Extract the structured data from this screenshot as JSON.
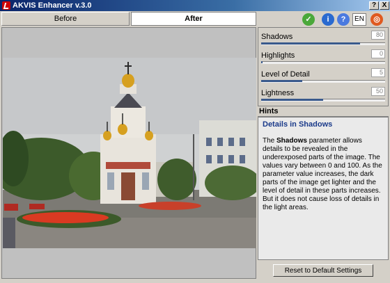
{
  "window": {
    "title": "AKVIS Enhancer v.3.0",
    "help_label": "?",
    "close_label": "X"
  },
  "tabs": [
    {
      "label": "Before"
    },
    {
      "label": "After"
    }
  ],
  "toolbar": {
    "language": "EN"
  },
  "params": [
    {
      "label": "Shadows",
      "value": "80",
      "fraction": 0.8
    },
    {
      "label": "Highlights",
      "value": "0",
      "fraction": 0.0
    },
    {
      "label": "Level of Detail",
      "value": "5",
      "fraction": 0.33
    },
    {
      "label": "Lightness",
      "value": "50",
      "fraction": 0.5
    }
  ],
  "hints": {
    "header": "Hints",
    "title": "Details in Shadows",
    "body_pre": "The ",
    "body_bold": "Shadows",
    "body_post": " parameter allows details to be revealed in the underexposed parts of the image. The values vary between 0 and 100. As the parameter value increases, the dark parts of the image get lighter and the level of detail in these parts increases. But it does not cause loss of details in the light areas."
  },
  "reset_label": "Reset to Default Settings",
  "colors": {
    "title_start": "#0a246a",
    "title_end": "#a6caf0",
    "hint_title": "#1a3a8a",
    "slider_fill": "#3a5a8c"
  }
}
